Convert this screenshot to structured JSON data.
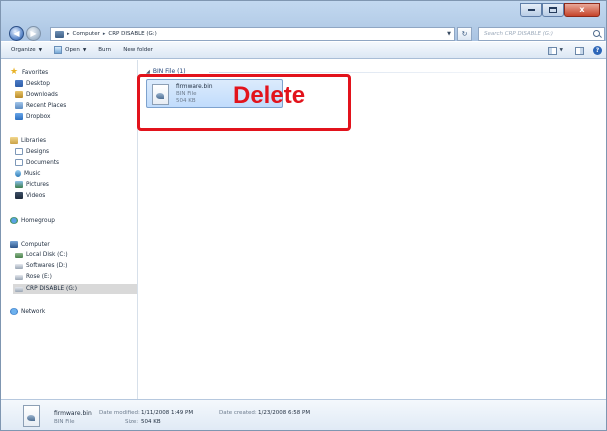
{
  "window": {
    "caption_buttons": [
      "minimize",
      "maximize",
      "close"
    ],
    "close_glyph": "x"
  },
  "address": {
    "crumbs": [
      "Computer",
      "CRP DISABLE (G:)"
    ],
    "search_placeholder": "Search CRP DISABLE (G:)"
  },
  "commandbar": {
    "organize": "Organize",
    "open": "Open",
    "burn": "Burn",
    "new_folder": "New folder"
  },
  "navpane": {
    "favorites": {
      "header": "Favorites",
      "items": [
        "Desktop",
        "Downloads",
        "Recent Places",
        "Dropbox"
      ]
    },
    "libraries": {
      "header": "Libraries",
      "items": [
        "Designs",
        "Documents",
        "Music",
        "Pictures",
        "Videos"
      ]
    },
    "homegroup": "Homegroup",
    "computer": {
      "header": "Computer",
      "items": [
        "Local Disk (C:)",
        "Softwares (D:)",
        "Rose (E:)",
        "CRP DISABLE (G:)"
      ],
      "selected": "CRP DISABLE (G:)"
    },
    "network": "Network"
  },
  "content": {
    "group_header": "BIN File (1)",
    "file": {
      "name": "firmware.bin",
      "type": "BIN File",
      "size": "504 KB"
    }
  },
  "annotation": {
    "text": "Delete",
    "color": "#e2131c"
  },
  "details": {
    "name": "firmware.bin",
    "type": "BIN File",
    "date_modified_label": "Date modified:",
    "date_modified": "1/11/2008 1:49 PM",
    "date_created_label": "Date created:",
    "date_created": "1/23/2008 6:58 PM",
    "size_label": "Size:",
    "size": "504 KB"
  }
}
